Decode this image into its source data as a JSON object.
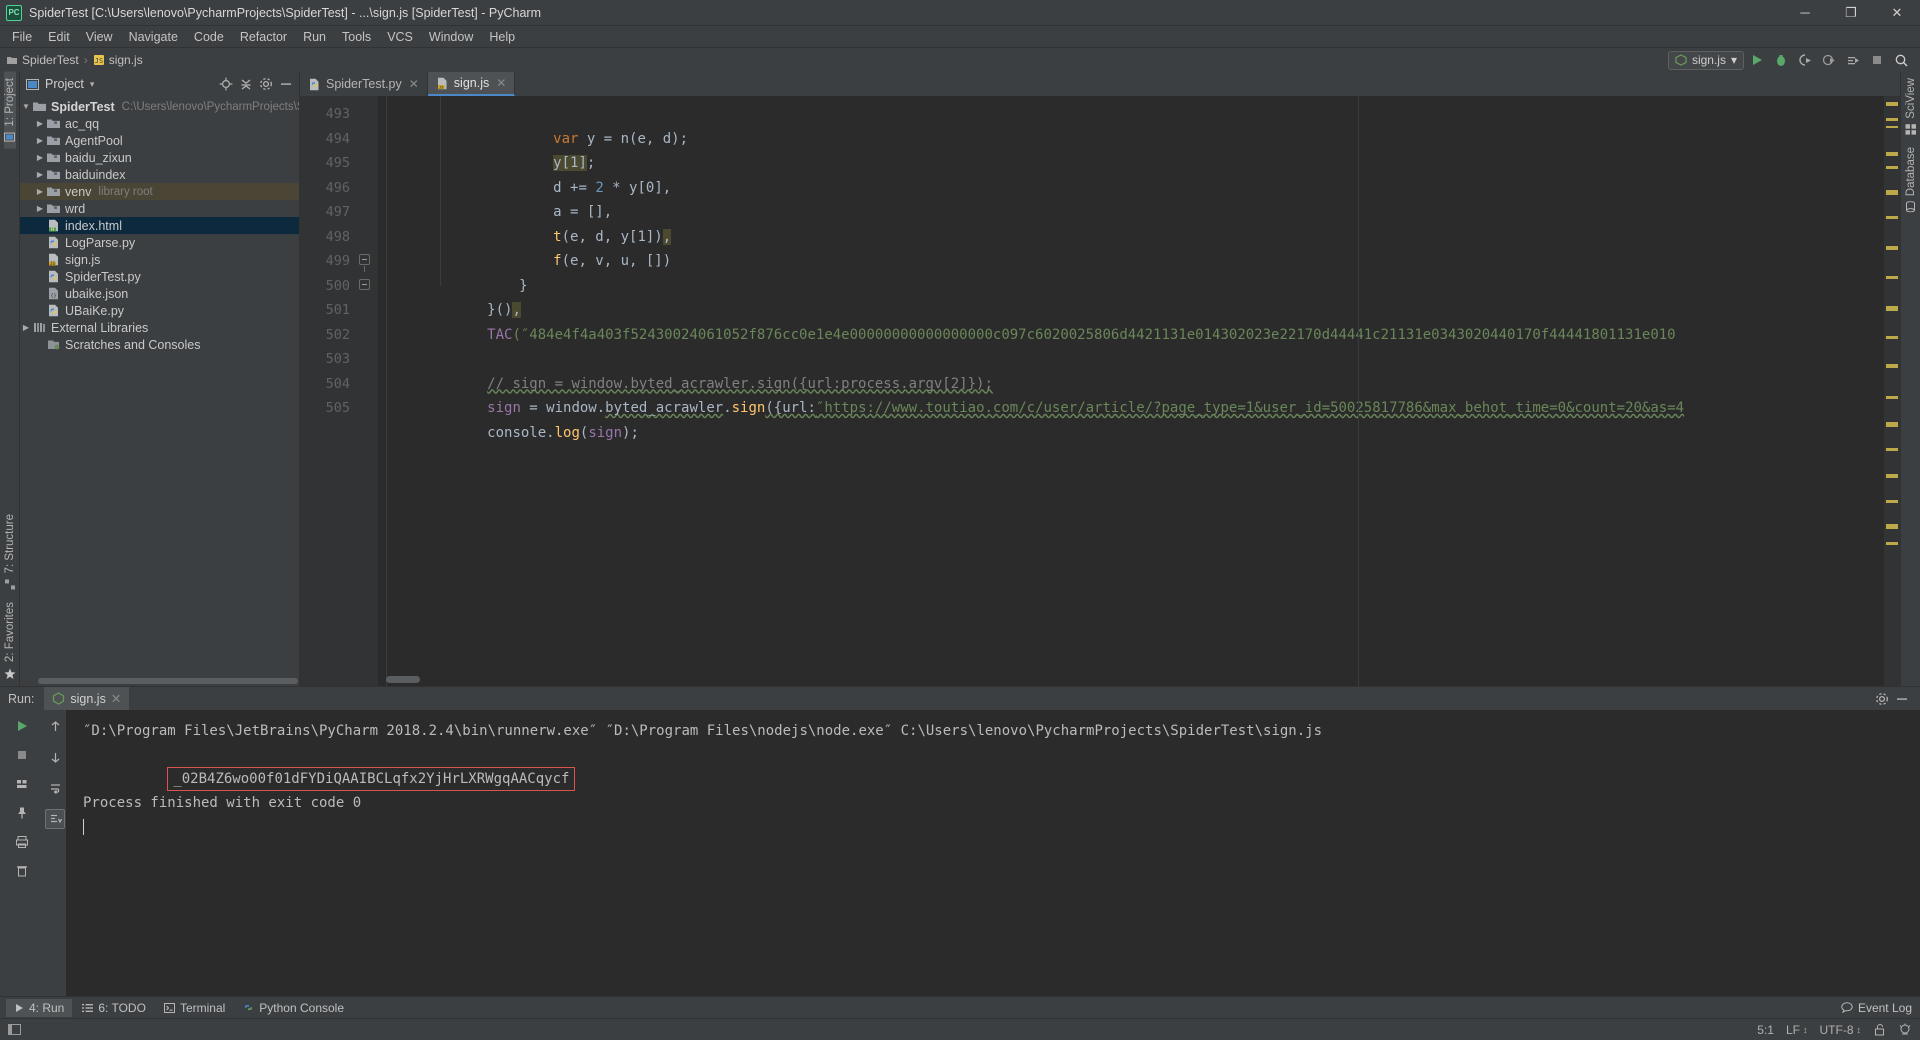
{
  "window": {
    "title": "SpiderTest [C:\\Users\\lenovo\\PycharmProjects\\SpiderTest] - ...\\sign.js [SpiderTest] - PyCharm",
    "app_icon_text": "PC",
    "minimize_label": "─",
    "maximize_label": "❐",
    "close_label": "✕"
  },
  "menubar": {
    "items": [
      {
        "label": "File"
      },
      {
        "label": "Edit"
      },
      {
        "label": "View"
      },
      {
        "label": "Navigate"
      },
      {
        "label": "Code"
      },
      {
        "label": "Refactor"
      },
      {
        "label": "Run"
      },
      {
        "label": "Tools"
      },
      {
        "label": "VCS"
      },
      {
        "label": "Window"
      },
      {
        "label": "Help"
      }
    ]
  },
  "breadcrumb": {
    "project": "SpiderTest",
    "separator": "›",
    "file": "sign.js"
  },
  "toolbar": {
    "run_config": "sign.js",
    "dropdown_caret": "▾",
    "buttons": [
      {
        "name": "run-button",
        "glyph": "▶"
      },
      {
        "name": "debug-button",
        "glyph": "🐞"
      },
      {
        "name": "run-coverage-button",
        "glyph": "◑"
      },
      {
        "name": "profile-button",
        "glyph": "◴"
      },
      {
        "name": "run-with-args-button",
        "glyph": "≡"
      },
      {
        "name": "stop-button",
        "glyph": "■"
      },
      {
        "name": "search-everywhere-button",
        "glyph": "🔍"
      }
    ]
  },
  "left_strip": {
    "project_label": "1: Project",
    "structure_label": "7: Structure",
    "favorites_label": "2: Favorites"
  },
  "right_strip": {
    "sciview_label": "SciView",
    "database_label": "Database"
  },
  "project_pane": {
    "title": "Project",
    "caret": "▾",
    "locate_icon": "target-icon",
    "collapse_icon": "collapse-all-icon",
    "settings_icon": "gear-icon",
    "hide_icon": "hide-icon",
    "tree": [
      {
        "indent": 0,
        "arrow": "▼",
        "icon": "folder",
        "label": "SpiderTest",
        "sub": "C:\\Users\\lenovo\\PycharmProjects\\Spider",
        "bold": true,
        "state": "none"
      },
      {
        "indent": 1,
        "arrow": "▶",
        "icon": "folder",
        "label": "ac_qq",
        "sub": "",
        "bold": false,
        "state": "none"
      },
      {
        "indent": 1,
        "arrow": "▶",
        "icon": "folder",
        "label": "AgentPool",
        "sub": "",
        "bold": false,
        "state": "none"
      },
      {
        "indent": 1,
        "arrow": "▶",
        "icon": "folder",
        "label": "baidu_zixun",
        "sub": "",
        "bold": false,
        "state": "none"
      },
      {
        "indent": 1,
        "arrow": "▶",
        "icon": "folder",
        "label": "baiduindex",
        "sub": "",
        "bold": false,
        "state": "none"
      },
      {
        "indent": 1,
        "arrow": "▶",
        "icon": "folder",
        "label": "venv",
        "sub": "library root",
        "bold": false,
        "state": "olive"
      },
      {
        "indent": 1,
        "arrow": "▶",
        "icon": "folder",
        "label": "wrd",
        "sub": "",
        "bold": false,
        "state": "none"
      },
      {
        "indent": 1,
        "arrow": "",
        "icon": "html",
        "label": "index.html",
        "sub": "",
        "bold": false,
        "state": "blue"
      },
      {
        "indent": 1,
        "arrow": "",
        "icon": "py",
        "label": "LogParse.py",
        "sub": "",
        "bold": false,
        "state": "none"
      },
      {
        "indent": 1,
        "arrow": "",
        "icon": "js",
        "label": "sign.js",
        "sub": "",
        "bold": false,
        "state": "none"
      },
      {
        "indent": 1,
        "arrow": "",
        "icon": "py",
        "label": "SpiderTest.py",
        "sub": "",
        "bold": false,
        "state": "none"
      },
      {
        "indent": 1,
        "arrow": "",
        "icon": "json",
        "label": "ubaike.json",
        "sub": "",
        "bold": false,
        "state": "none"
      },
      {
        "indent": 1,
        "arrow": "",
        "icon": "py",
        "label": "UBaiKe.py",
        "sub": "",
        "bold": false,
        "state": "none"
      },
      {
        "indent": 0,
        "arrow": "▶",
        "icon": "lib",
        "label": "External Libraries",
        "sub": "",
        "bold": false,
        "state": "none"
      },
      {
        "indent": 0,
        "arrow": "",
        "icon": "scratch",
        "label": "Scratches and Consoles",
        "sub": "",
        "bold": false,
        "state": "none"
      }
    ]
  },
  "editor": {
    "tabs": [
      {
        "label": "SpiderTest.py",
        "icon": "python-file-icon",
        "active": false,
        "close": "✕"
      },
      {
        "label": "sign.js",
        "icon": "javascript-file-icon",
        "active": true,
        "close": "✕"
      }
    ],
    "lines": [
      {
        "n": "493",
        "fold": "none"
      },
      {
        "n": "494",
        "fold": "none"
      },
      {
        "n": "495",
        "fold": "none"
      },
      {
        "n": "496",
        "fold": "none"
      },
      {
        "n": "497",
        "fold": "none"
      },
      {
        "n": "498",
        "fold": "none"
      },
      {
        "n": "499",
        "fold": "mid"
      },
      {
        "n": "500",
        "fold": "end"
      },
      {
        "n": "501",
        "fold": "none"
      },
      {
        "n": "502",
        "fold": "none"
      },
      {
        "n": "503",
        "fold": "none"
      },
      {
        "n": "504",
        "fold": "none"
      },
      {
        "n": "505",
        "fold": "none"
      }
    ],
    "code": {
      "l493": {
        "kw": "var",
        "rest": " y = n(e, d);"
      },
      "l494_hl": "y[1]",
      "l494_rest": ";",
      "l495": "d += ",
      "l495_num": "2",
      "l495_rest": " * y[0],",
      "l496": "a = [],",
      "l497_fn": "t",
      "l497_args": "(e, d, y[1])",
      "l497_comma": ",",
      "l498_fn": "f",
      "l498_args": "(e, v, u, [])",
      "l499": "}",
      "l500": "}()",
      "l500_comma": ",",
      "l501_fn": "TAC",
      "l501_str": "(″484e4f4a403f52430024061052f876cc0e1e4e00000000000000000c097c6020025806d4421131e014302023e22170d44441c21131e0343020440170f44441801131e010",
      "l503_comment": "// sign = window.byted_acrawler.sign({url:process.argv[2]});",
      "l504_a": "sign",
      "l504_b": " = window.",
      "l504_c": "byted_acrawler",
      "l504_d": ".",
      "l504_e": "sign",
      "l504_f": "({url:",
      "l504_url": "″https://www.toutiao.com/c/user/article/?page_type=1&user_id=50025817786&max_behot_time=0&count=20&as=4",
      "l505_a": "console.",
      "l505_fn": "log",
      "l505_b": "(",
      "l505_arg": "sign",
      "l505_c": ");"
    }
  },
  "run_panel": {
    "label": "Run:",
    "tab": {
      "label": "sign.js",
      "icon": "nodejs-icon",
      "close": "✕"
    },
    "settings_icon": "gear-icon",
    "hide_icon": "hide-icon",
    "side_buttons": [
      {
        "name": "rerun-button",
        "glyph": "▶"
      },
      {
        "name": "stop-button",
        "glyph": "■"
      },
      {
        "name": "layout-button",
        "glyph": "▣"
      },
      {
        "name": "pin-button",
        "glyph": "📌"
      },
      {
        "name": "print-button",
        "glyph": "⎙"
      },
      {
        "name": "delete-button",
        "glyph": "🗑"
      }
    ],
    "side_buttons2": [
      {
        "name": "scroll-up-button",
        "glyph": "↑"
      },
      {
        "name": "scroll-down-button",
        "glyph": "↓"
      },
      {
        "name": "soft-wrap-button",
        "glyph": "↵"
      },
      {
        "name": "scroll-to-end-button",
        "glyph": "↧"
      }
    ],
    "output": {
      "command": "″D:\\Program Files\\JetBrains\\PyCharm 2018.2.4\\bin\\runnerw.exe″ ″D:\\Program Files\\nodejs\\node.exe″ C:\\Users\\lenovo\\PycharmProjects\\SpiderTest\\sign.js",
      "result": "_02B4Z6wo00f01dFYDiQAAIBCLqfx2YjHrLXRWgqAACqycf",
      "result_highlight_color": "#d9534f",
      "exit": "Process finished with exit code 0"
    }
  },
  "bottom_tools": [
    {
      "label": "4: Run",
      "icon": "run-icon",
      "active": true
    },
    {
      "label": "6: TODO",
      "icon": "todo-icon",
      "active": false
    },
    {
      "label": "Terminal",
      "icon": "terminal-icon",
      "active": false
    },
    {
      "label": "Python Console",
      "icon": "python-icon",
      "active": false
    }
  ],
  "event_log": {
    "label": "Event Log",
    "icon": "balloon-icon"
  },
  "statusbar": {
    "caret_position": "5:1",
    "line_separator": "LF",
    "encoding": "UTF-8",
    "lock_icon": "unlocked-icon",
    "inspection_icon": "hector-icon",
    "caret": "↕"
  },
  "colors": {
    "accent_blue": "#4a88c7",
    "selection_blue": "#0d293e",
    "olive": "#4b4535",
    "gutter": "#313335",
    "editor_bg": "#2b2b2b",
    "panel_bg": "#3c3f41",
    "marker_yellow": "#bba94a",
    "green_run": "#59a869",
    "string_green": "#6a8759",
    "keyword_orange": "#cc7832"
  }
}
